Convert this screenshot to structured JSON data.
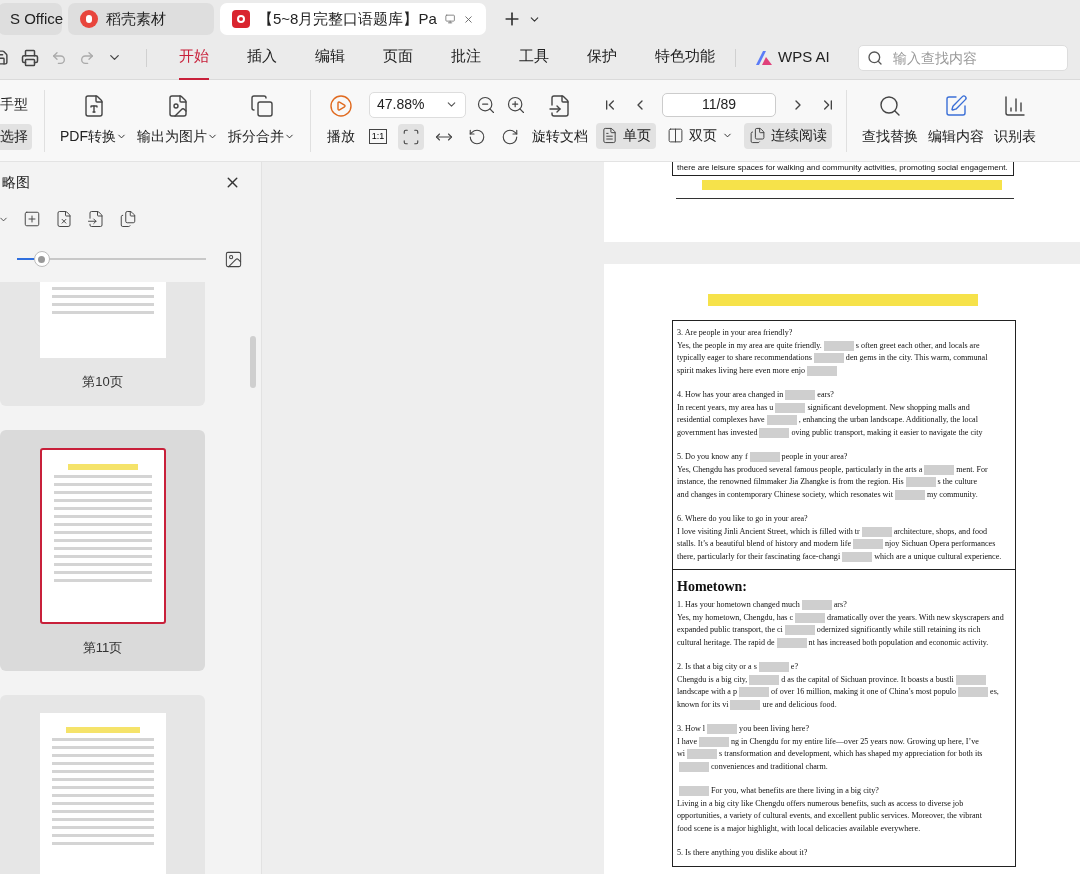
{
  "app_tabs": [
    {
      "label": "S Office",
      "kind": "home",
      "selected": false
    },
    {
      "label": "稻壳素材",
      "kind": "docer",
      "selected": false
    },
    {
      "label": "【5~8月完整口语题库】Pa",
      "kind": "pdf",
      "selected": true
    }
  ],
  "menu": [
    {
      "label": "开始",
      "selected": true
    },
    {
      "label": "插入",
      "selected": false
    },
    {
      "label": "编辑",
      "selected": false
    },
    {
      "label": "页面",
      "selected": false
    },
    {
      "label": "批注",
      "selected": false
    },
    {
      "label": "工具",
      "selected": false
    },
    {
      "label": "保护",
      "selected": false
    },
    {
      "label": "特色功能",
      "selected": false
    }
  ],
  "ai_button": "WPS AI",
  "search": {
    "placeholder": "输入查找内容"
  },
  "toolbar": {
    "modes": [
      {
        "label": "手型",
        "selected": false
      },
      {
        "label": "选择",
        "selected": true
      }
    ],
    "big": [
      {
        "label": "PDF转换",
        "kind": "convert"
      },
      {
        "label": "输出为图片",
        "kind": "image"
      },
      {
        "label": "拆分合并",
        "kind": "split"
      }
    ],
    "play": "播放",
    "zoom": "47.88%",
    "view_tools": [
      {
        "kind": "actual",
        "label": "1:1",
        "selected": false
      },
      {
        "kind": "fit_page",
        "selected": true
      },
      {
        "kind": "fit_width",
        "selected": false
      },
      {
        "kind": "rotate_left",
        "selected": false
      },
      {
        "kind": "rotate_right",
        "selected": false
      }
    ],
    "rotate": "旋转文档",
    "page": "11/89",
    "layouts": [
      {
        "label": "单页",
        "kind": "single",
        "selected": true,
        "has_menu": false
      },
      {
        "label": "双页",
        "kind": "double",
        "selected": false,
        "has_menu": true
      },
      {
        "label": "连续阅读",
        "kind": "continuous",
        "selected": true,
        "has_menu": false
      }
    ],
    "right": [
      {
        "label": "查找替换",
        "kind": "find"
      },
      {
        "label": "编辑内容",
        "kind": "edit"
      },
      {
        "label": "识别表",
        "kind": "table"
      }
    ]
  },
  "sidebar": {
    "title": "略图",
    "thumb_size": {
      "level": 0.13
    },
    "thumbnails": [
      {
        "label": "第10页",
        "selected": false
      },
      {
        "label": "第11页",
        "selected": true
      },
      {
        "selected": false
      }
    ]
  },
  "document": {
    "prev_page_last_line": "there are leisure spaces for walking and community activities, promoting social engagement.",
    "sections": [
      {
        "paragraphs": [
          [
            [
              {
                "kind": "text",
                "text": "3. Are people in your area friendly?"
              }
            ],
            [
              {
                "kind": "text",
                "text": "Yes, the people in my area are quite friendly."
              },
              {
                "kind": "hidden"
              },
              {
                "kind": "text",
                "text": "s often greet each other, and locals are"
              }
            ],
            [
              {
                "kind": "text",
                "text": "typically eager to share recommendations"
              },
              {
                "kind": "hidden"
              },
              {
                "kind": "text",
                "text": "den gems in the city. This warm, communal"
              }
            ],
            [
              {
                "kind": "text",
                "text": "spirit makes living here even more enjo"
              },
              {
                "kind": "hidden"
              }
            ]
          ],
          [
            [
              {
                "kind": "text",
                "text": "4. How has your area changed in"
              },
              {
                "kind": "hidden"
              },
              {
                "kind": "text",
                "text": "ears?"
              }
            ],
            [
              {
                "kind": "text",
                "text": "In recent years, my area has u"
              },
              {
                "kind": "hidden"
              },
              {
                "kind": "text",
                "text": "significant development. New shopping malls and"
              }
            ],
            [
              {
                "kind": "text",
                "text": "residential complexes have"
              },
              {
                "kind": "hidden"
              },
              {
                "kind": "text",
                "text": ", enhancing the urban landscape. Additionally, the local"
              }
            ],
            [
              {
                "kind": "text",
                "text": "government has invested"
              },
              {
                "kind": "hidden"
              },
              {
                "kind": "text",
                "text": "oving public transport, making it easier to navigate the city"
              }
            ]
          ],
          [
            [
              {
                "kind": "text",
                "text": "5. Do you know any f"
              },
              {
                "kind": "hidden"
              },
              {
                "kind": "text",
                "text": "people in your area?"
              }
            ],
            [
              {
                "kind": "text",
                "text": "Yes, Chengdu has produced several famous people, particularly in the arts a"
              },
              {
                "kind": "hidden"
              },
              {
                "kind": "text",
                "text": "ment. For"
              }
            ],
            [
              {
                "kind": "text",
                "text": "instance, the renowned filmmaker Jia Zhangke is from the region. His"
              },
              {
                "kind": "hidden"
              },
              {
                "kind": "text",
                "text": "s the culture"
              }
            ],
            [
              {
                "kind": "text",
                "text": "and changes in contemporary Chinese society, which resonates wit"
              },
              {
                "kind": "hidden"
              },
              {
                "kind": "text",
                "text": "my community."
              }
            ]
          ],
          [
            [
              {
                "kind": "text",
                "text": "6. Where do you like to go in your area?"
              }
            ],
            [
              {
                "kind": "text",
                "text": "I love visiting Jinli Ancient Street, which is filled with tr"
              },
              {
                "kind": "hidden"
              },
              {
                "kind": "text",
                "text": "architecture, shops, and food"
              }
            ],
            [
              {
                "kind": "text",
                "text": "stalls. It’s a beautiful blend of history and modern life"
              },
              {
                "kind": "hidden"
              },
              {
                "kind": "text",
                "text": "njoy Sichuan Opera performances"
              }
            ],
            [
              {
                "kind": "text",
                "text": "there, particularly for their fascinating face-changi"
              },
              {
                "kind": "hidden"
              },
              {
                "kind": "text",
                "text": "which are a unique cultural experience."
              }
            ]
          ]
        ]
      },
      {
        "heading": "Hometown:",
        "paragraphs": [
          [
            [
              {
                "kind": "text",
                "text": "1. Has your hometown changed much"
              },
              {
                "kind": "hidden"
              },
              {
                "kind": "text",
                "text": "ars?"
              }
            ],
            [
              {
                "kind": "text",
                "text": "Yes, my hometown, Chengdu, has c"
              },
              {
                "kind": "hidden"
              },
              {
                "kind": "text",
                "text": "dramatically over the years. With new skyscrapers and"
              }
            ],
            [
              {
                "kind": "text",
                "text": "expanded public transport, the ci"
              },
              {
                "kind": "hidden"
              },
              {
                "kind": "text",
                "text": "odernized significantly while still retaining its rich"
              }
            ],
            [
              {
                "kind": "text",
                "text": "cultural heritage. The rapid de"
              },
              {
                "kind": "hidden"
              },
              {
                "kind": "text",
                "text": "nt has increased both population and economic activity."
              }
            ]
          ],
          [
            [
              {
                "kind": "text",
                "text": "2. Is that a big city or a s"
              },
              {
                "kind": "hidden"
              },
              {
                "kind": "text",
                "text": "e?"
              }
            ],
            [
              {
                "kind": "text",
                "text": "Chengdu is a big city,"
              },
              {
                "kind": "hidden"
              },
              {
                "kind": "text",
                "text": "d as the capital of Sichuan province. It boasts a bustli"
              },
              {
                "kind": "hidden"
              }
            ],
            [
              {
                "kind": "text",
                "text": "landscape with a p"
              },
              {
                "kind": "hidden"
              },
              {
                "kind": "text",
                "text": "of over 16 million, making it one of China’s most populo"
              },
              {
                "kind": "hidden"
              },
              {
                "kind": "text",
                "text": "es,"
              }
            ],
            [
              {
                "kind": "text",
                "text": "known for its vi"
              },
              {
                "kind": "hidden"
              },
              {
                "kind": "text",
                "text": "ure and delicious food."
              }
            ]
          ],
          [
            [
              {
                "kind": "text",
                "text": "3. How l"
              },
              {
                "kind": "hidden"
              },
              {
                "kind": "text",
                "text": "you been living here?"
              }
            ],
            [
              {
                "kind": "text",
                "text": "I have"
              },
              {
                "kind": "hidden"
              },
              {
                "kind": "text",
                "text": "ng in Chengdu for my entire life—over 25 years now. Growing up here, I’ve"
              }
            ],
            [
              {
                "kind": "text",
                "text": "wi"
              },
              {
                "kind": "hidden"
              },
              {
                "kind": "text",
                "text": "s transformation and development, which has shaped my appreciation for both its"
              }
            ],
            [
              {
                "kind": "hidden"
              },
              {
                "kind": "text",
                "text": "conveniences and traditional charm."
              }
            ]
          ],
          [
            [
              {
                "kind": "hidden"
              },
              {
                "kind": "text",
                "text": "For you, what benefits are there living in a big city?"
              }
            ],
            [
              {
                "kind": "text",
                "text": "Living in a big city like Chengdu offers numerous benefits, such as access to diverse job"
              }
            ],
            [
              {
                "kind": "text",
                "text": "opportunities, a variety of cultural events, and excellent public services. Moreover, the vibrant"
              }
            ],
            [
              {
                "kind": "text",
                "text": "food scene is a major highlight, with local delicacies available everywhere."
              }
            ]
          ],
          [
            [
              {
                "kind": "text",
                "text": "5. Is there anything you dislike about it?"
              }
            ]
          ]
        ]
      }
    ]
  }
}
